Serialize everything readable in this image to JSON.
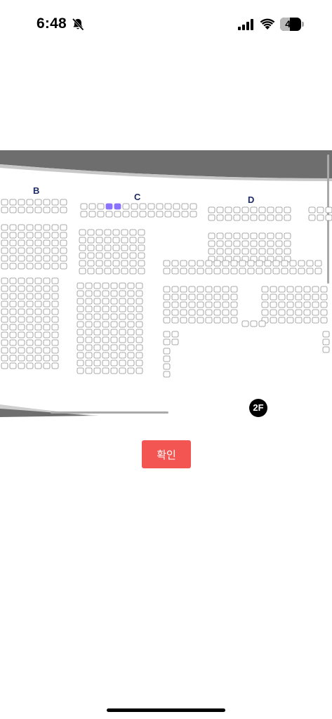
{
  "status_bar": {
    "time": "6:48",
    "battery_level": "47"
  },
  "seat_map": {
    "sections": [
      {
        "label": "B"
      },
      {
        "label": "C"
      },
      {
        "label": "D"
      }
    ],
    "floor_label": "2F",
    "selected_seat_color": "#8b73ff",
    "seat_border_color": "#8f8f8f"
  },
  "confirm_button": {
    "label": "확인",
    "color": "#f25552"
  }
}
